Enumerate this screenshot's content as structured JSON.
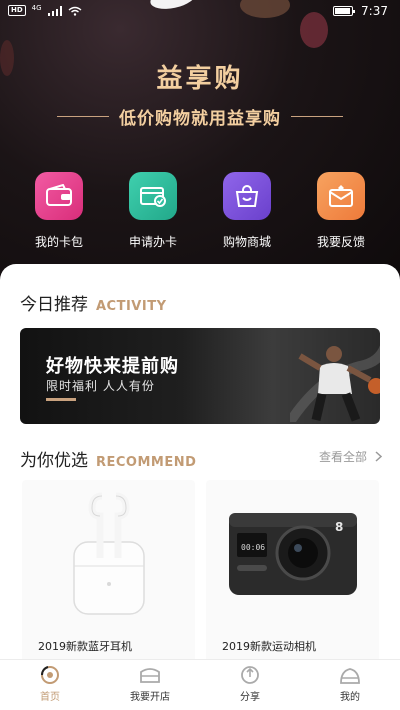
{
  "status_bar": {
    "badge": "HD",
    "network": "4G",
    "time": "7:37"
  },
  "header": {
    "app_title": "益享购",
    "slogan": "低价购物就用益享购",
    "quick_nav": [
      {
        "label": "我的卡包",
        "icon": "wallet-icon",
        "color": "#e83a8c"
      },
      {
        "label": "申请办卡",
        "icon": "credit-card-icon",
        "color": "#2fbfa0"
      },
      {
        "label": "购物商城",
        "icon": "shopping-bag-icon",
        "color": "#7b52d9"
      },
      {
        "label": "我要反馈",
        "icon": "feedback-envelope-icon",
        "color": "#f2894a"
      }
    ]
  },
  "today": {
    "title_cn": "今日推荐",
    "title_en": "ACTIVITY",
    "banner": {
      "title": "好物快来提前购",
      "subtitle": "限时福利 人人有份"
    }
  },
  "recommend": {
    "title_cn": "为你优选",
    "title_en": "RECOMMEND",
    "see_all": "查看全部",
    "products": [
      {
        "name": "2019新款蓝牙耳机",
        "icon": "earbuds-icon"
      },
      {
        "name": "2019新款运动相机",
        "icon": "action-camera-icon",
        "badge": "8"
      }
    ]
  },
  "tabbar": {
    "active": 0,
    "tabs": [
      {
        "label": "首页",
        "icon": "home-icon"
      },
      {
        "label": "我要开店",
        "icon": "store-icon"
      },
      {
        "label": "分享",
        "icon": "share-icon"
      },
      {
        "label": "我的",
        "icon": "profile-icon"
      }
    ]
  },
  "colors": {
    "accent": "#c29b74",
    "title_gold": "#f3cfa0",
    "header_bg": "#1b1416"
  }
}
